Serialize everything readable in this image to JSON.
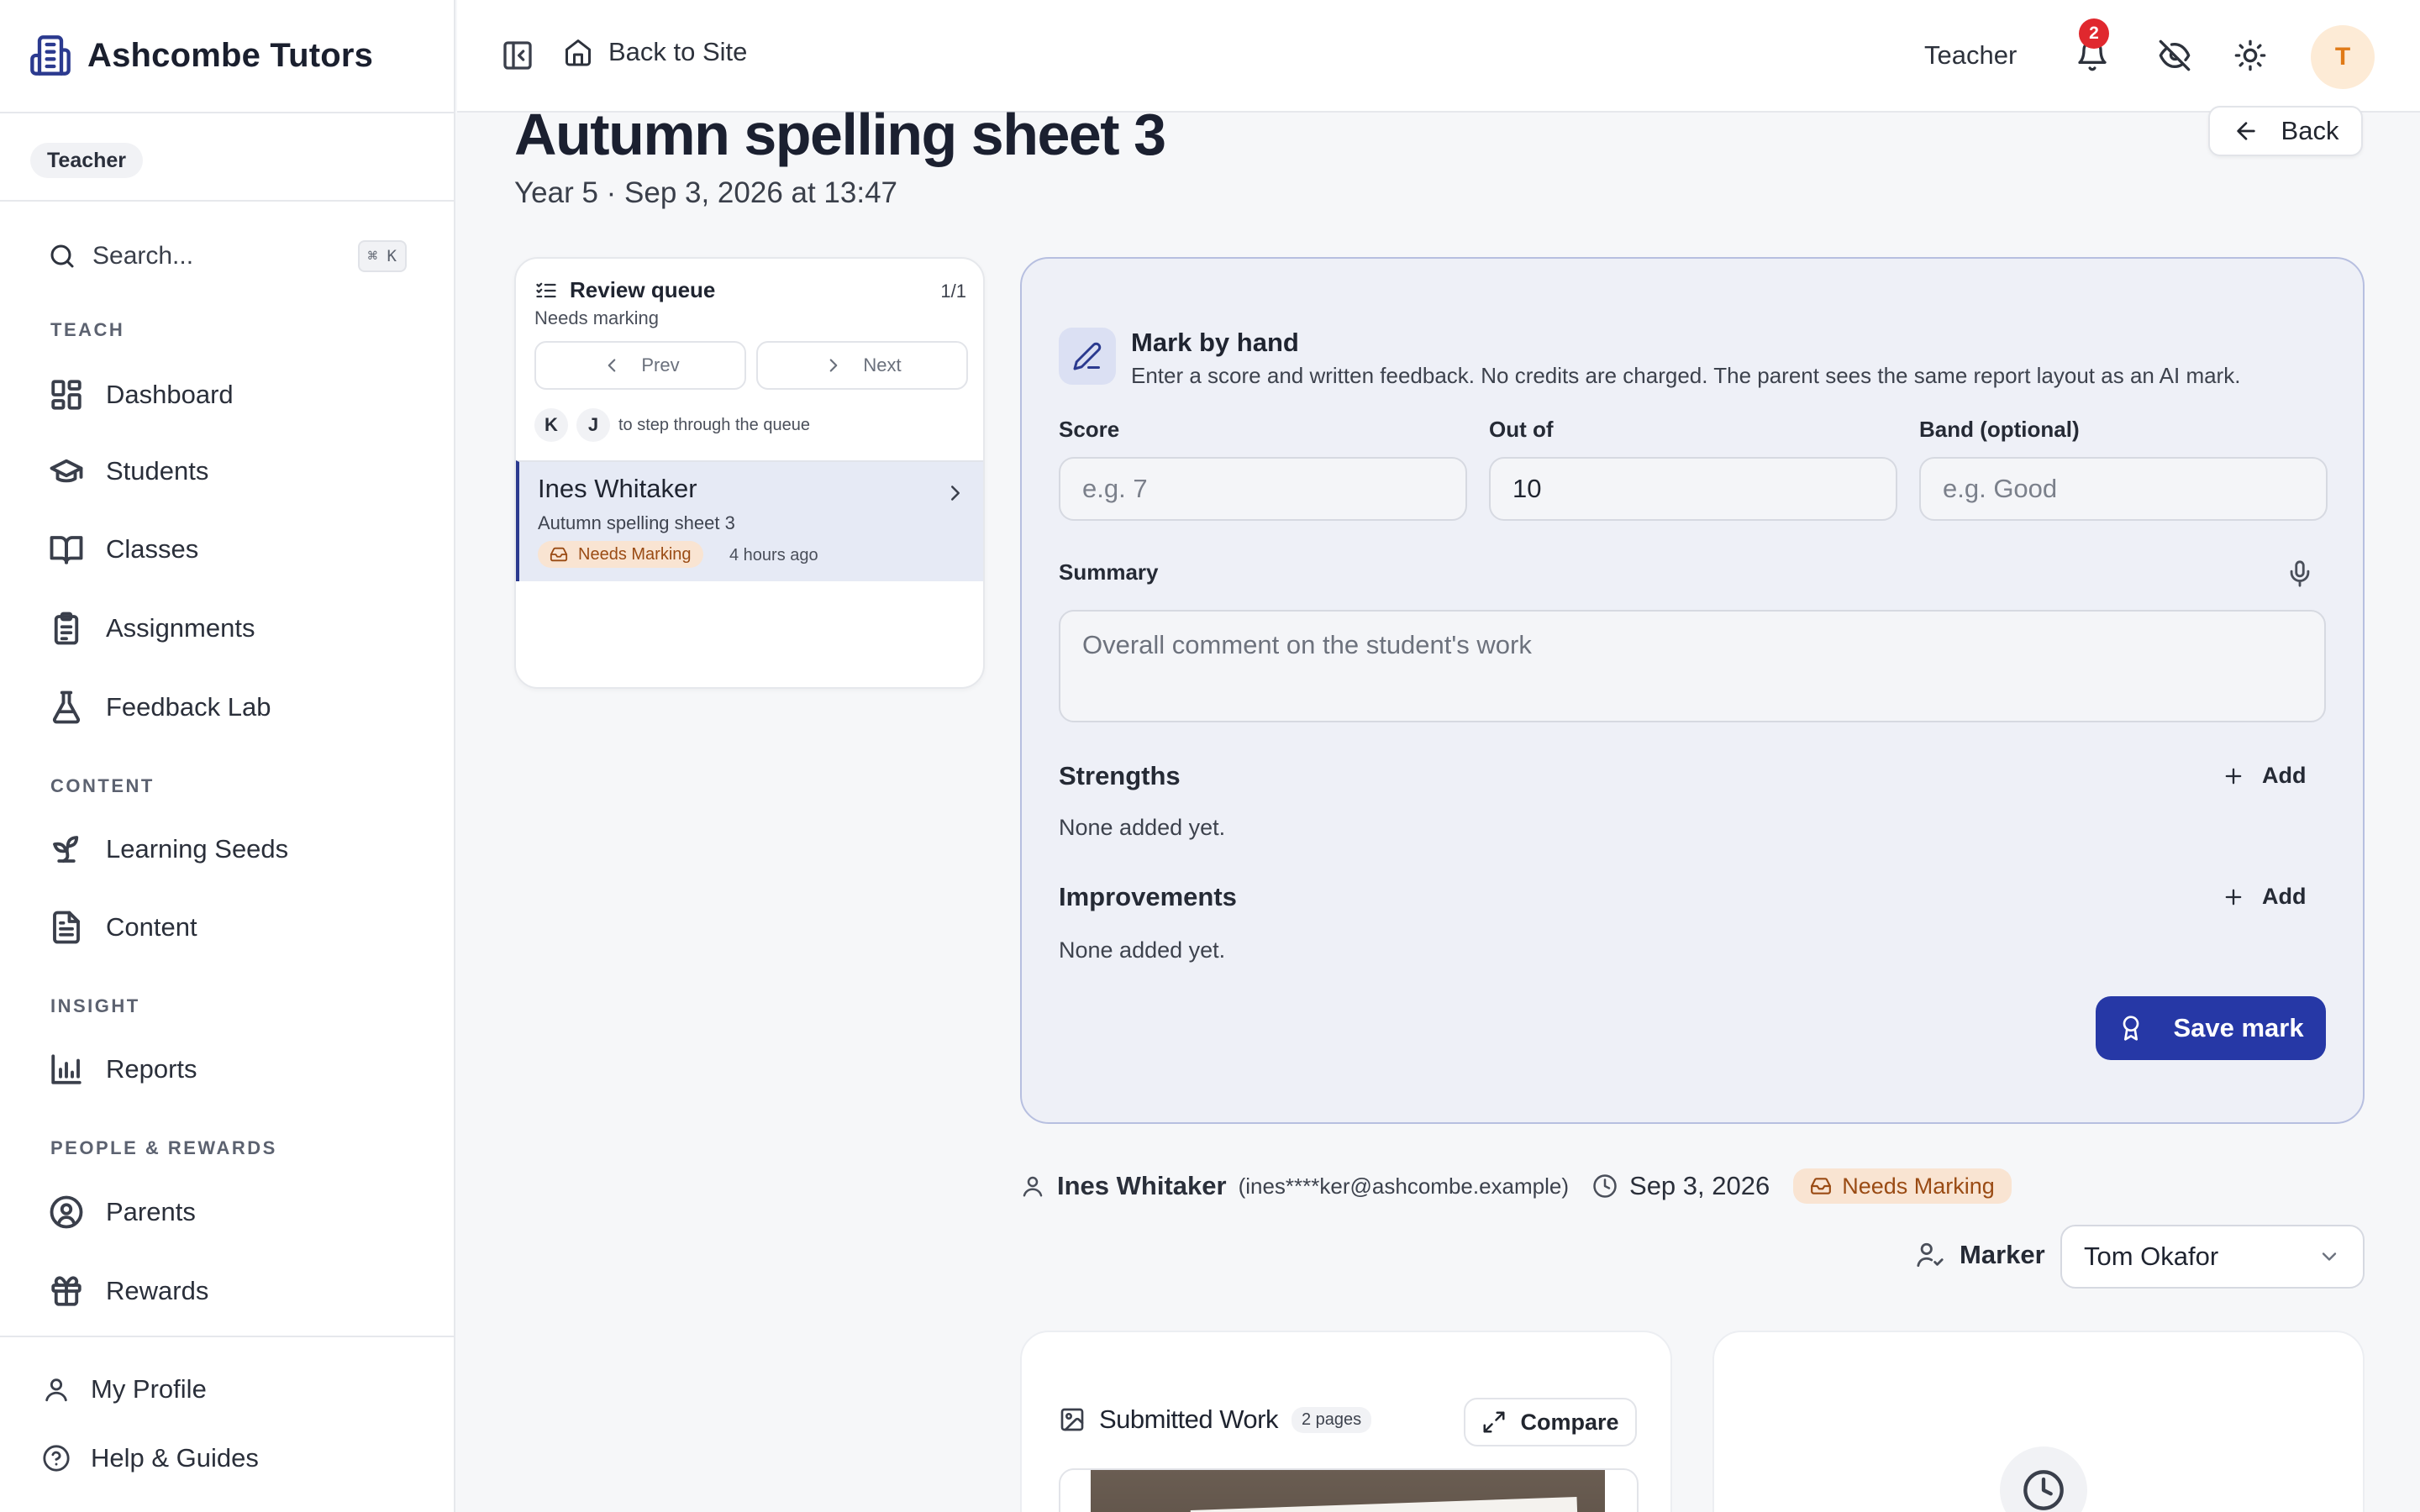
{
  "brand": {
    "name": "Ashcombe Tutors"
  },
  "sidebar": {
    "role": "Teacher",
    "search": {
      "placeholder": "Search...",
      "shortcut": "⌘ K"
    },
    "sections": {
      "teach": "TEACH",
      "content": "CONTENT",
      "insight": "INSIGHT",
      "people": "PEOPLE & REWARDS"
    },
    "items": {
      "dashboard": "Dashboard",
      "students": "Students",
      "classes": "Classes",
      "assignments": "Assignments",
      "feedback_lab": "Feedback Lab",
      "learning_seeds": "Learning Seeds",
      "content": "Content",
      "reports": "Reports",
      "parents": "Parents",
      "rewards": "Rewards"
    },
    "footer": {
      "profile": "My Profile",
      "help": "Help & Guides"
    }
  },
  "topbar": {
    "back_to_site": "Back to Site",
    "role": "Teacher",
    "notification_count": "2",
    "avatar_initial": "T"
  },
  "page": {
    "title": "Autumn spelling sheet 3",
    "subtitle": "Year 5 · Sep 3, 2026 at 13:47",
    "back": "Back"
  },
  "queue": {
    "title": "Review queue",
    "count": "1/1",
    "subtitle": "Needs marking",
    "prev": "Prev",
    "next": "Next",
    "key1": "K",
    "key2": "J",
    "keys_hint": "to step through the queue",
    "item": {
      "student": "Ines Whitaker",
      "assignment": "Autumn spelling sheet 3",
      "status": "Needs Marking",
      "ago": "4 hours ago"
    }
  },
  "mark": {
    "title": "Mark by hand",
    "description": "Enter a score and written feedback. No credits are charged. The parent sees the same report layout as an AI mark.",
    "score_label": "Score",
    "score_placeholder": "e.g. 7",
    "outof_label": "Out of",
    "outof_value": "10",
    "band_label": "Band (optional)",
    "band_placeholder": "e.g. Good",
    "summary_label": "Summary",
    "summary_placeholder": "Overall comment on the student's work",
    "strengths_label": "Strengths",
    "strengths_empty": "None added yet.",
    "improvements_label": "Improvements",
    "improvements_empty": "None added yet.",
    "add": "Add",
    "save": "Save mark"
  },
  "meta": {
    "student": "Ines Whitaker",
    "email": "(ines****ker@ashcombe.example)",
    "date": "Sep 3, 2026",
    "status": "Needs Marking",
    "marker_label": "Marker",
    "marker_value": "Tom Okafor"
  },
  "submitted": {
    "title": "Submitted Work",
    "pages": "2 pages",
    "compare": "Compare"
  },
  "colors": {
    "accent": "#2638a6",
    "badge": "#e0282e",
    "status_bg": "#f9e4d2",
    "status_fg": "#9a4b14"
  }
}
